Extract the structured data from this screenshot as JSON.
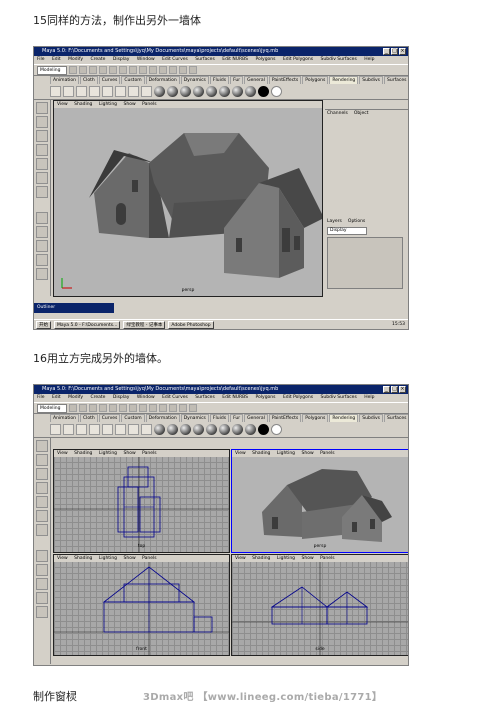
{
  "captions": {
    "step15": "15同样的方法，制作出另外一墙体",
    "step16": "16用立方完成另外的墙体。",
    "next": "制作窗棂"
  },
  "window": {
    "title": "Maya 5.0: F:\\Documents and Settings\\jyq\\My Documents\\maya\\projects\\default\\scenes\\jyq.mb",
    "title2": "Maya 5.0: F:\\Documents and Settings\\jyq\\My Documents\\maya\\projects\\default\\scenes\\jyq.mb",
    "min": "_",
    "max": "□",
    "close": "×"
  },
  "menu": [
    "File",
    "Edit",
    "Modify",
    "Create",
    "Display",
    "Window",
    "Edit Curves",
    "Surfaces",
    "Edit NURBS",
    "Polygons",
    "Edit Polygons",
    "Subdiv Surfaces",
    "Help"
  ],
  "mode_select": "Modeling",
  "shelf_tabs": [
    "Animation",
    "Cloth",
    "Curves",
    "Custom",
    "Deformation",
    "Dynamics",
    "Fluids",
    "Fur",
    "General",
    "PaintEffects",
    "Polygons",
    "Rendering",
    "Subdivs",
    "Surfaces"
  ],
  "shelf_active": "Rendering",
  "viewport_menu": [
    "View",
    "Shading",
    "Lighting",
    "Show",
    "Panels"
  ],
  "labels": {
    "persp": "persp",
    "top": "top",
    "front": "front",
    "side": "side"
  },
  "channel_box": {
    "tabs": [
      "Channels",
      "Object"
    ],
    "layers_tabs": [
      "Layers",
      "Options"
    ],
    "display_select": "Display"
  },
  "outliner_title": "Outliner",
  "taskbar": {
    "start": "开始",
    "items": [
      "Maya 5.0 - F:\\Documents...",
      "绿宝教程 - 记事本",
      "Adobe Photoshop"
    ],
    "clock": "15:53"
  },
  "watermark": "3Dmax吧 【www.lineeg.com/tieba/1771】"
}
